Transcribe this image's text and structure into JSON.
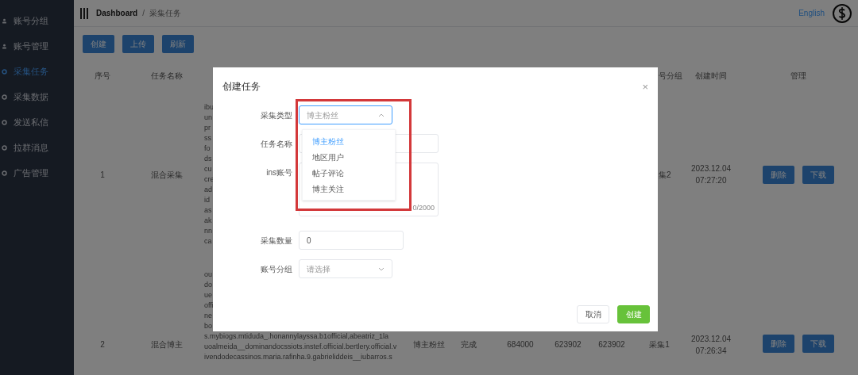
{
  "sidebar": {
    "items": [
      {
        "label": "账号分组",
        "selected": false
      },
      {
        "label": "账号管理",
        "selected": false
      },
      {
        "label": "采集任务",
        "selected": true
      },
      {
        "label": "采集数据",
        "selected": false
      },
      {
        "label": "发送私信",
        "selected": false
      },
      {
        "label": "拉群消息",
        "selected": false
      },
      {
        "label": "广告管理",
        "selected": false
      }
    ]
  },
  "header": {
    "breadcrumb": [
      "Dashboard",
      "采集任务"
    ],
    "separator": "/",
    "language": "English"
  },
  "toolbar": {
    "buttons": [
      "创建",
      "上传",
      "刷新"
    ]
  },
  "table": {
    "columns": {
      "no": "序号",
      "task_name": "任务名称",
      "column_9": "号分组",
      "created": "创建时间",
      "manage": "管理"
    },
    "rows": [
      {
        "no": "1",
        "task_name": "混合采集",
        "column_3": [
          "ibu",
          "un",
          "pr",
          "ss",
          "fo",
          "ds",
          "cu",
          "cre",
          "ad",
          "id",
          "as",
          "ak",
          "nn",
          "ca"
        ],
        "column_9": "集2",
        "created": "2023.12.04 07:27:20",
        "actions": [
          "删除",
          "下载"
        ]
      },
      {
        "no": "2",
        "task_name": "混合博主",
        "column_3": [
          "ou",
          "do",
          "ue",
          "offi",
          "ne",
          "bo",
          "s.mybiogs.mtiduda_.honannylayssa.b1official,abeatriz_1la",
          "uoalmeida__dominandocssiots.instef.official.bertlery.official.v",
          "ivendodecassinos.maria.rafinha.9.gabrieliddeis__iubarros.s"
        ],
        "column_4": "博主粉丝",
        "column_5": "完成",
        "column_6": "684000",
        "column_7": "623902",
        "column_8": "623902",
        "column_9": "采集1",
        "created": "2023.12.04 07:26:34",
        "actions": [
          "删除",
          "下载"
        ]
      }
    ]
  },
  "dialog": {
    "title": "创建任务",
    "close": "×",
    "fields": [
      {
        "kind": "select",
        "label": "采集类型",
        "placeholder": "博主粉丝",
        "expanded": true,
        "options": [
          {
            "label": "博主粉丝",
            "selected": true
          },
          {
            "label": "地区用户",
            "selected": false
          },
          {
            "label": "帖子评论",
            "selected": false
          },
          {
            "label": "博主关注",
            "selected": false
          }
        ]
      },
      {
        "kind": "input",
        "label": "任务名称"
      },
      {
        "kind": "textarea",
        "label": "ins账号",
        "counter": "0/2000"
      },
      {
        "kind": "input",
        "label": "采集数量",
        "value": "0"
      },
      {
        "kind": "select",
        "label": "账号分组",
        "placeholder": "请选择",
        "expanded": false
      }
    ],
    "buttons": [
      {
        "label": "取消",
        "kind": "secondary"
      },
      {
        "label": "创建",
        "kind": "primary"
      }
    ],
    "highlight": true
  }
}
